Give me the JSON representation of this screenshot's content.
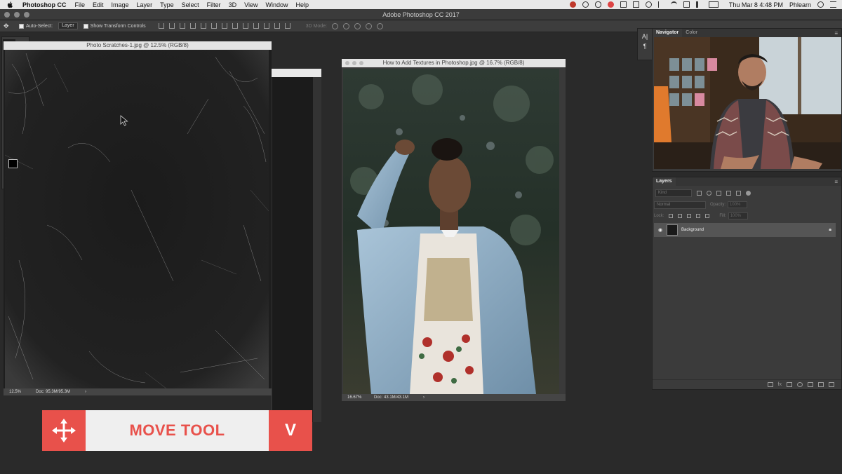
{
  "menubar": {
    "app_name": "Photoshop CC",
    "items": [
      "File",
      "Edit",
      "Image",
      "Layer",
      "Type",
      "Select",
      "Filter",
      "3D",
      "View",
      "Window",
      "Help"
    ],
    "clock": "Thu Mar 8  4:48 PM",
    "user": "Phlearn"
  },
  "app_title": "Adobe Photoshop CC 2017",
  "options_bar": {
    "auto_select_label": "Auto-Select:",
    "auto_select_value": "Layer",
    "transform_label": "Show Transform Controls",
    "mode_3d_label": "3D Mode:"
  },
  "documents": {
    "scratches": {
      "title": "Photo Scratches-1.jpg @ 12.5% (RGB/8)",
      "zoom": "12.5%",
      "doc_size": "Doc: 95.3M/95.3M"
    },
    "photo": {
      "title": "How to Add Textures in Photoshop.jpg @ 16.7% (RGB/8)",
      "zoom": "16.67%",
      "doc_size": "Doc: 43.1M/43.1M"
    }
  },
  "panels": {
    "navigator_tab": "Navigator",
    "color_tab": "Color",
    "layers_tab": "Layers",
    "kind_placeholder": "Kind",
    "blend_mode": "Normal",
    "opacity_label": "Opacity:",
    "opacity_value": "100%",
    "lock_label": "Lock:",
    "fill_label": "Fill:",
    "fill_value": "100%",
    "layer_name": "Background"
  },
  "banner": {
    "tool_name": "MOVE TOOL",
    "shortcut": "V",
    "accent_color": "#e8514b"
  }
}
